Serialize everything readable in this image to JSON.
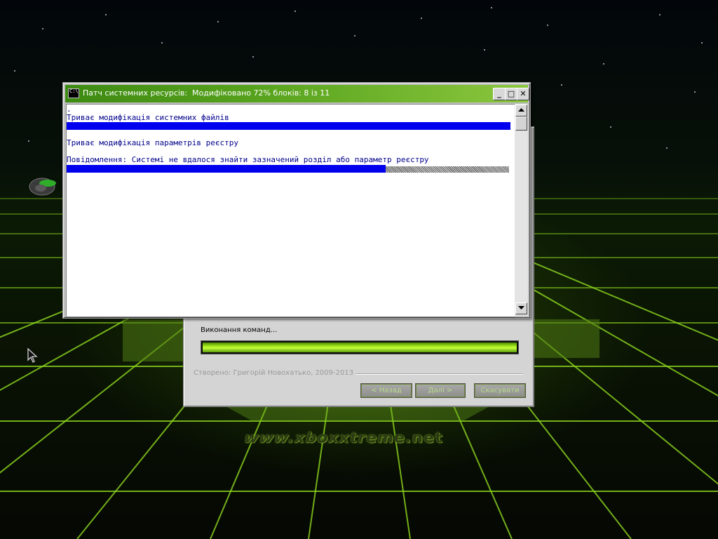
{
  "console": {
    "title": "Патч системних ресурсів:  Модифіковано 72% блоків: 8 із 11",
    "lines": [
      ".",
      "Триває модифікація системних файлів",
      "Триває модифікація параметрів реєстру",
      "Повідомлення: Системі не вдалося знайти зазначений розділ або параметр реєстру"
    ],
    "minimize_glyph": "_",
    "maximize_glyph": "□",
    "close_glyph": "✕",
    "icon_text": "C:\\"
  },
  "installer": {
    "status": "Виконання команд...",
    "progress": 1.0,
    "credits": "Створено: Григорій Новохатько, 2009-2013",
    "buttons": {
      "back": "< Назад",
      "next": "Далі >",
      "cancel": "Скасувати"
    }
  },
  "desktop": {
    "watermark": "www.xboxxtreme.net"
  },
  "colors": {
    "title_bar": "#56a21c",
    "console_text": "#00008b",
    "console_bar": "#0000ee",
    "progress": "#a6ec1c"
  },
  "icons": [
    "console-app-icon",
    "minimize-icon",
    "maximize-icon",
    "close-icon",
    "scroll-up-icon",
    "scroll-down-icon",
    "mouse-cursor-icon",
    "desktop-shortcut-icon"
  ]
}
